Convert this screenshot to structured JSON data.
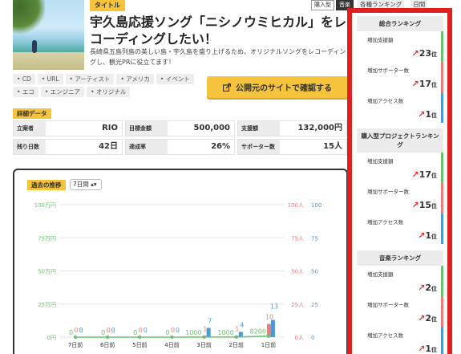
{
  "project": {
    "tag_label": "タイトル",
    "title": "宇久島応援ソング「ニシノウミヒカル」をレコーディングしたい！",
    "description": "長崎県五島列島の美しい島・宇久島を盛り上げるため、オリジナルソングをレコーディングし、観光PRに役立てます！",
    "badges": [
      "購入型",
      "音楽"
    ],
    "tags": [
      "CD",
      "URL",
      "アーティスト",
      "アメリカ",
      "イベント",
      "エコ",
      "エンジニア",
      "オリジナル"
    ],
    "open_button": "公開元のサイトで確認する"
  },
  "details": {
    "label": "詳細データ",
    "rows": [
      [
        {
          "k": "立案者",
          "v": "RIO"
        },
        {
          "k": "目標金額",
          "v": "500,000"
        },
        {
          "k": "支援額",
          "v": "132,000円"
        }
      ],
      [
        {
          "k": "残り日数",
          "v": "42日"
        },
        {
          "k": "達成率",
          "v": "26%"
        },
        {
          "k": "サポーター数",
          "v": "15人"
        }
      ]
    ]
  },
  "history": {
    "label": "過去の推移",
    "period": "7日間"
  },
  "chart_data": {
    "type": "bar",
    "categories": [
      "7日前",
      "6日前",
      "5日前",
      "4日前",
      "3日前",
      "2日前",
      "1日前"
    ],
    "series": [
      {
        "values": [
          0,
          0,
          0,
          0,
          1000,
          1000,
          8200
        ],
        "color": "#6ac36a"
      },
      {
        "values": [
          0,
          0,
          0,
          0,
          1,
          1,
          10
        ],
        "color": "#ef7b7b"
      },
      {
        "values": [
          0,
          0,
          0,
          0,
          7,
          4,
          13
        ],
        "color": "#4a9ad8"
      }
    ],
    "y_left": {
      "ticks": [
        "0円",
        "25万円",
        "50万円",
        "75万円",
        "100万円"
      ],
      "range": [
        0,
        1000000
      ]
    },
    "y_mid": {
      "ticks": [
        "0人",
        "25人",
        "50人",
        "75人",
        "100人"
      ],
      "range": [
        0,
        100
      ]
    },
    "y_right": {
      "ticks": [
        "0",
        "25",
        "50",
        "75",
        "100"
      ],
      "range": [
        0,
        100
      ]
    },
    "labels": {
      "amount": [
        "0",
        "0",
        "0",
        "0",
        "1000",
        "1000",
        "8200"
      ],
      "supporters": [
        "0",
        "0",
        "0",
        "0",
        "1",
        "1",
        "10"
      ],
      "access": [
        "0",
        "0",
        "0",
        "0",
        "7",
        "4",
        "13"
      ]
    }
  },
  "sidebar": {
    "head": [
      "各種ランキング",
      "日間"
    ],
    "sections": [
      {
        "title": "総合ランキング",
        "items": [
          {
            "label": "増加支援額",
            "rank": "23",
            "unit": "位",
            "color": "green"
          },
          {
            "label": "増加サポーター数",
            "rank": "17",
            "unit": "位",
            "color": "red"
          },
          {
            "label": "増加アクセス数",
            "rank": "1",
            "unit": "位",
            "color": "blue"
          }
        ]
      },
      {
        "title": "購入型プロジェクトランキング",
        "items": [
          {
            "label": "増加支援額",
            "rank": "17",
            "unit": "位",
            "color": "green"
          },
          {
            "label": "増加サポーター数",
            "rank": "15",
            "unit": "位",
            "color": "red"
          },
          {
            "label": "増加アクセス数",
            "rank": "1",
            "unit": "位",
            "color": "blue"
          }
        ]
      },
      {
        "title": "音楽ランキング",
        "items": [
          {
            "label": "増加支援額",
            "rank": "2",
            "unit": "位",
            "color": "green"
          },
          {
            "label": "増加サポーター数",
            "rank": "2",
            "unit": "位",
            "color": "red"
          },
          {
            "label": "増加アクセス数",
            "rank": "1",
            "unit": "位",
            "color": "blue"
          }
        ]
      }
    ]
  }
}
